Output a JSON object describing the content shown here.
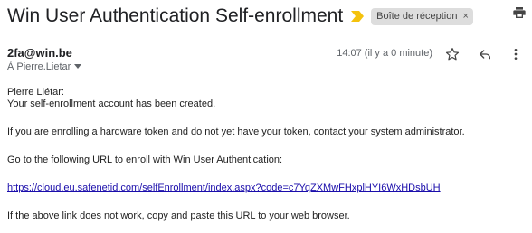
{
  "email": {
    "subject": "Win User Authentication Self-enrollment",
    "label": "Boîte de réception",
    "label_close": "×",
    "sender": "2fa@win.be",
    "recipient": "À Pierre.Lietar",
    "timestamp": "14:07 (il y a 0 minute)",
    "body": {
      "greeting": "Pierre Liétar:",
      "line1": "Your self-enrollment account has been created.",
      "line2": "If you are enrolling a hardware token and do not yet have your token, contact your system administrator.",
      "line3": "Go to the following URL to enroll with Win User Authentication:",
      "link": "https://cloud.eu.safenetid.com/selfEnrollment/index.aspx?code=c7YqZXMwFHxplHYI6WxHDsbUH",
      "line4": "If the above link does not work, copy and paste this URL to your web browser."
    }
  },
  "icons": {
    "important": "important-marker-icon",
    "print": "print-icon",
    "recipient_dropdown": "chevron-down-icon",
    "star": "star-icon",
    "reply": "reply-icon",
    "more": "more-vert-icon"
  },
  "colors": {
    "important_marker": "#f4c20d",
    "link": "#1a0dab",
    "chip_background": "#dddddd"
  }
}
